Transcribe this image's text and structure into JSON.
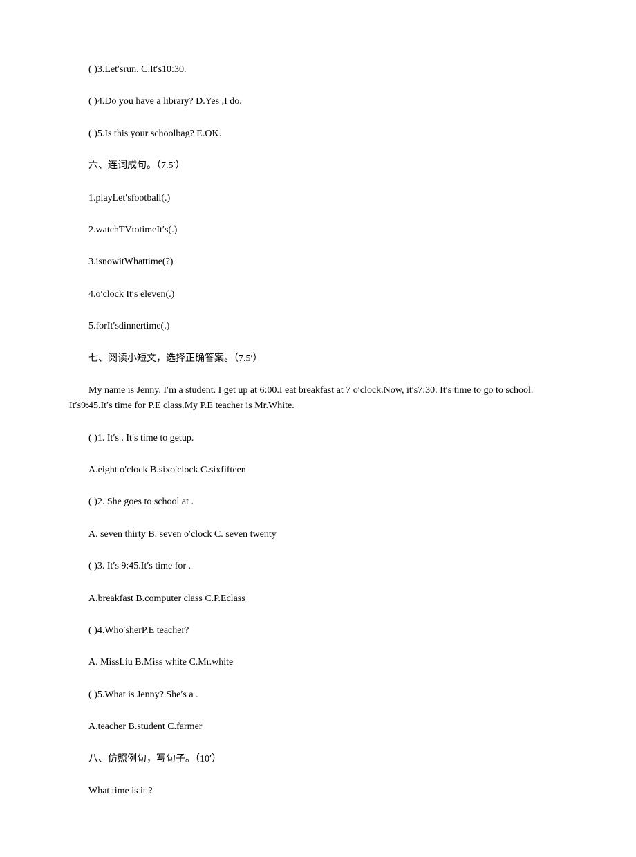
{
  "lines": {
    "match3": "( )3.Let′srun. C.It′s10:30.",
    "match4": "( )4.Do you have a library? D.Yes ,I do.",
    "match5": "( )5.Is this your schoolbag? E.OK.",
    "section6_heading": "六、连词成句。（7.5′）",
    "s6q1": "1.playLet′sfootball(.)",
    "s6q2": "2.watchTVtotimeIt′s(.)",
    "s6q3": "3.isnowitWhattime(?)",
    "s6q4": "4.o′clock It′s eleven(.)",
    "s6q5": "5.forIt′sdinnertime(.)",
    "section7_heading": "七、阅读小短文，选择正确答案。（7.5′）",
    "passage": "My name is Jenny. I′m a student. I get up at 6:00.I eat breakfast at 7 o′clock.Now, it′s7:30. It′s time to go to school. It′s9:45.It′s time for P.E class.My P.E teacher is Mr.White.",
    "s7q1": "( )1. It′s . It′s time to getup.",
    "s7q1_opts": "A.eight o′clock B.sixo′clock C.sixfifteen",
    "s7q2": "( )2. She goes to school at .",
    "s7q2_opts": "A. seven thirty B. seven o′clock C. seven twenty",
    "s7q3": "( )3. It′s 9:45.It′s time for .",
    "s7q3_opts": "A.breakfast B.computer class C.P.Eclass",
    "s7q4": "( )4.Who′sherP.E teacher?",
    "s7q4_opts": "A. MissLiu B.Miss white C.Mr.white",
    "s7q5": "( )5.What is Jenny? She′s a .",
    "s7q5_opts": "A.teacher B.student C.farmer",
    "section8_heading": "八、仿照例句，写句子。（10′）",
    "s8_example": "What time is it ?"
  }
}
